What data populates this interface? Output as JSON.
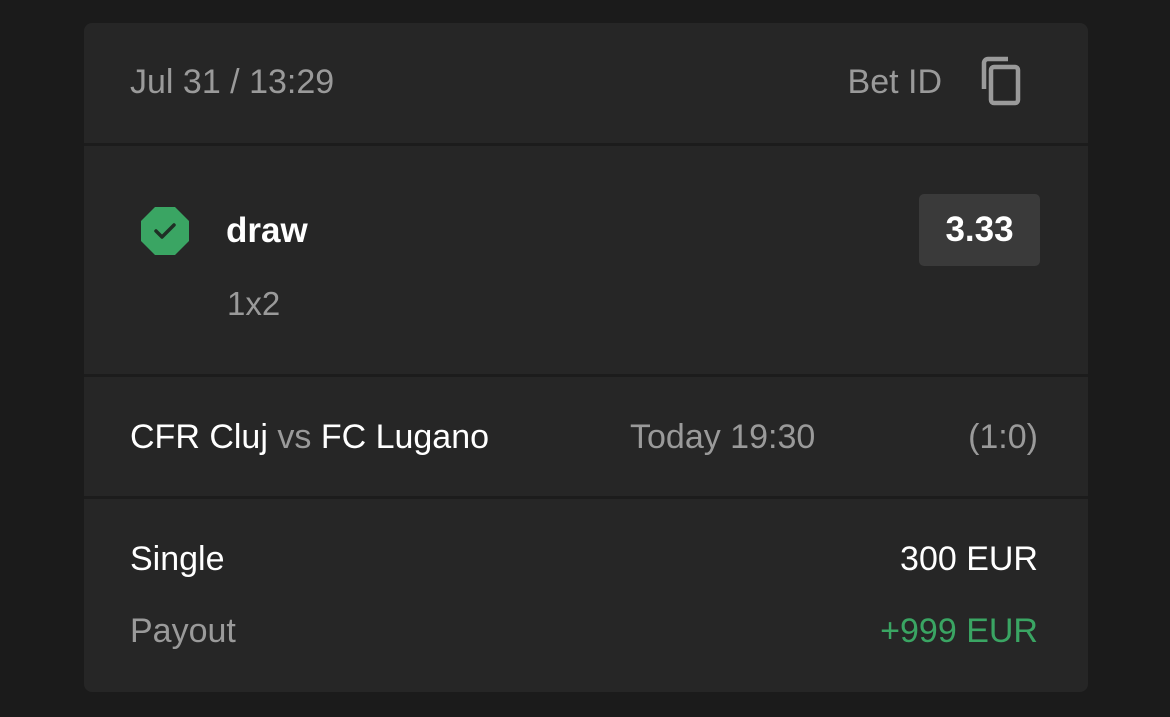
{
  "header": {
    "datetime": "Jul 31 / 13:29",
    "bet_id_label": "Bet ID",
    "copy_icon": "copy-icon"
  },
  "selection": {
    "status_icon": "check-octagon-icon",
    "status_color": "#3aa563",
    "name": "draw",
    "market": "1x2",
    "odds": "3.33"
  },
  "match": {
    "home_team": "CFR Cluj",
    "vs": "vs",
    "away_team": "FC Lugano",
    "time": "Today 19:30",
    "score": "(1:0)"
  },
  "summary": {
    "bet_type": "Single",
    "stake": "300 EUR",
    "payout_label": "Payout",
    "payout_value": "+999 EUR",
    "payout_color": "#3aa563"
  }
}
